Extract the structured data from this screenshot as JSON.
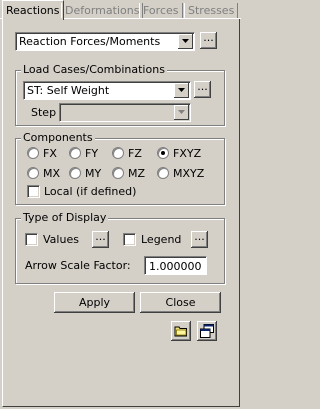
{
  "tabs": [
    {
      "label": "Reactions",
      "active": true
    },
    {
      "label": "Deformations",
      "active": false
    },
    {
      "label": "Forces",
      "active": false
    },
    {
      "label": "Stresses",
      "active": false
    }
  ],
  "result_type": {
    "selected": "Reaction Forces/Moments",
    "browse_label": "..."
  },
  "load_cases": {
    "title": "Load Cases/Combinations",
    "selected": "ST: Self Weight",
    "browse_label": "...",
    "step_label": "Step",
    "step_value": ""
  },
  "components": {
    "title": "Components",
    "options": [
      {
        "label": "FX",
        "checked": false
      },
      {
        "label": "FY",
        "checked": false
      },
      {
        "label": "FZ",
        "checked": false
      },
      {
        "label": "FXYZ",
        "checked": true
      },
      {
        "label": "MX",
        "checked": false
      },
      {
        "label": "MY",
        "checked": false
      },
      {
        "label": "MZ",
        "checked": false
      },
      {
        "label": "MXYZ",
        "checked": false
      }
    ],
    "local_label": "Local (if defined)",
    "local_checked": false
  },
  "display": {
    "title": "Type of Display",
    "values_label": "Values",
    "values_checked": false,
    "legend_label": "Legend",
    "legend_checked": false,
    "browse_label": "...",
    "arrow_scale_label": "Arrow Scale Factor:",
    "arrow_scale_value": "1.000000"
  },
  "buttons": {
    "apply": "Apply",
    "close": "Close"
  },
  "icons": {
    "open": "folder-icon",
    "copy": "copy-windows-icon"
  }
}
